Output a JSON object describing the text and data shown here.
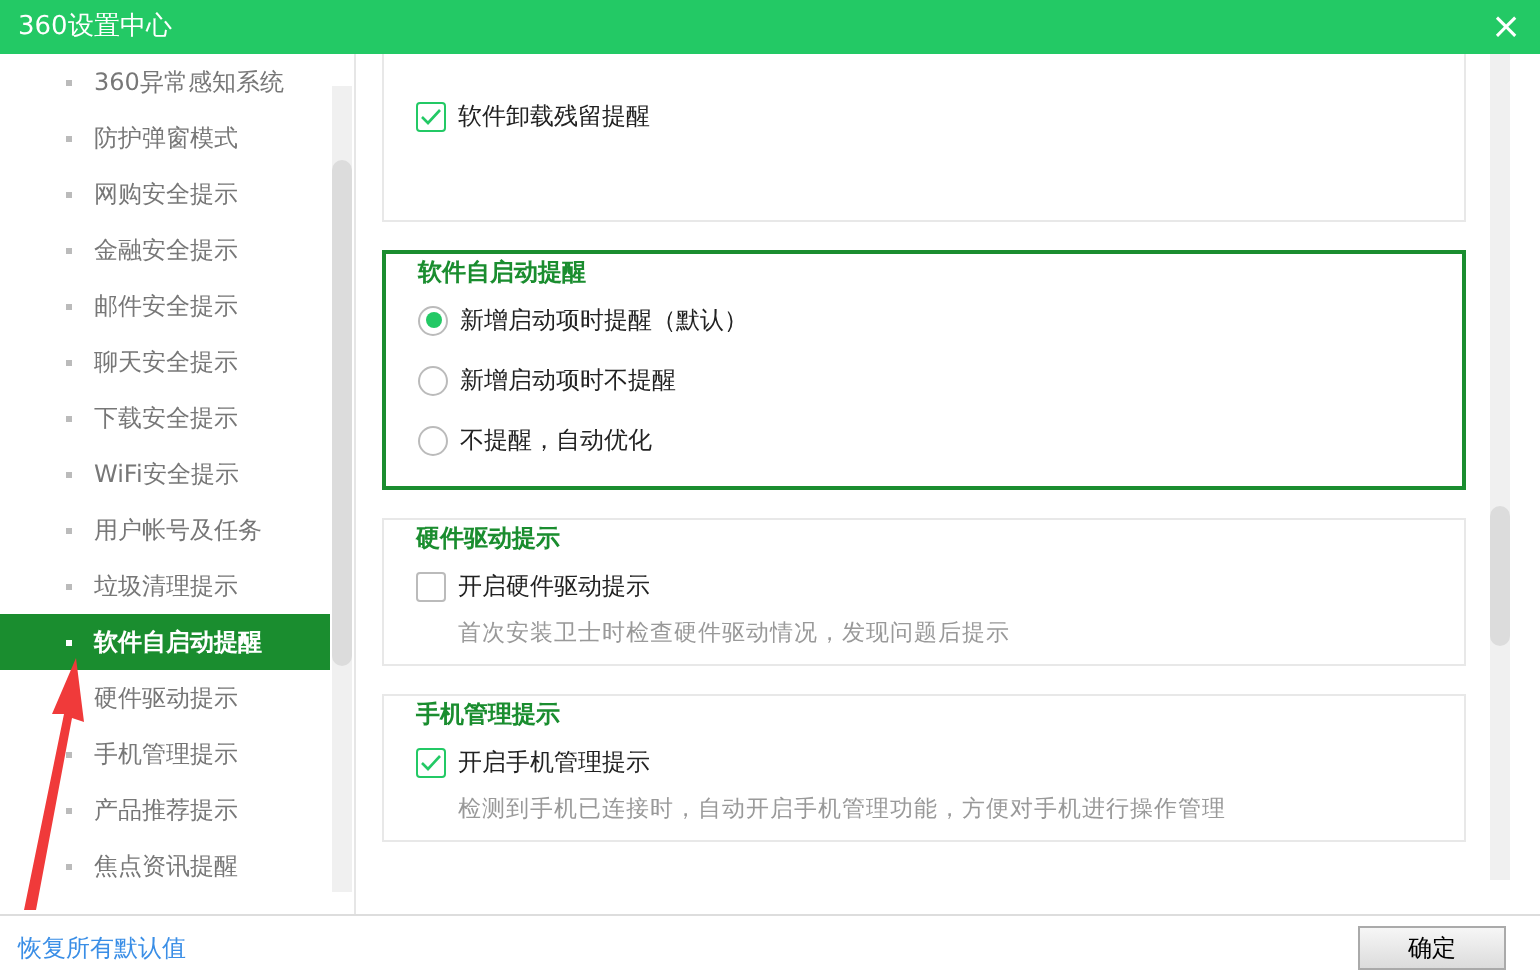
{
  "window": {
    "title": "360设置中心",
    "close": "×"
  },
  "sidebar": {
    "items": [
      {
        "label": "360异常感知系统",
        "selected": false
      },
      {
        "label": "防护弹窗模式",
        "selected": false
      },
      {
        "label": "网购安全提示",
        "selected": false
      },
      {
        "label": "金融安全提示",
        "selected": false
      },
      {
        "label": "邮件安全提示",
        "selected": false
      },
      {
        "label": "聊天安全提示",
        "selected": false
      },
      {
        "label": "下载安全提示",
        "selected": false
      },
      {
        "label": "WiFi安全提示",
        "selected": false
      },
      {
        "label": "用户帐号及任务",
        "selected": false
      },
      {
        "label": "垃圾清理提示",
        "selected": false
      },
      {
        "label": "软件自启动提醒",
        "selected": true
      },
      {
        "label": "硬件驱动提示",
        "selected": false
      },
      {
        "label": "手机管理提示",
        "selected": false
      },
      {
        "label": "产品推荐提示",
        "selected": false
      },
      {
        "label": "焦点资讯提醒",
        "selected": false
      }
    ]
  },
  "sections": [
    {
      "highlighted": false,
      "options": [
        {
          "kind": "checkbox",
          "label": "软件卸载残留提醒",
          "checked": true
        }
      ]
    },
    {
      "title": "软件自启动提醒",
      "highlighted": true,
      "options": [
        {
          "kind": "radio",
          "label": "新增启动项时提醒（默认）",
          "checked": true
        },
        {
          "kind": "radio",
          "label": "新增启动项时不提醒",
          "checked": false
        },
        {
          "kind": "radio",
          "label": "不提醒，自动优化",
          "checked": false
        }
      ]
    },
    {
      "title": "硬件驱动提示",
      "highlighted": false,
      "options": [
        {
          "kind": "checkbox",
          "label": "开启硬件驱动提示",
          "checked": false
        }
      ],
      "description": "首次安装卫士时检查硬件驱动情况，发现问题后提示"
    },
    {
      "title": "手机管理提示",
      "highlighted": false,
      "options": [
        {
          "kind": "checkbox",
          "label": "开启手机管理提示",
          "checked": true
        }
      ],
      "description": "检测到手机已连接时，自动开启手机管理功能，方便对手机进行操作管理"
    }
  ],
  "footer": {
    "restore_link": "恢复所有默认值",
    "ok_button": "确定"
  }
}
